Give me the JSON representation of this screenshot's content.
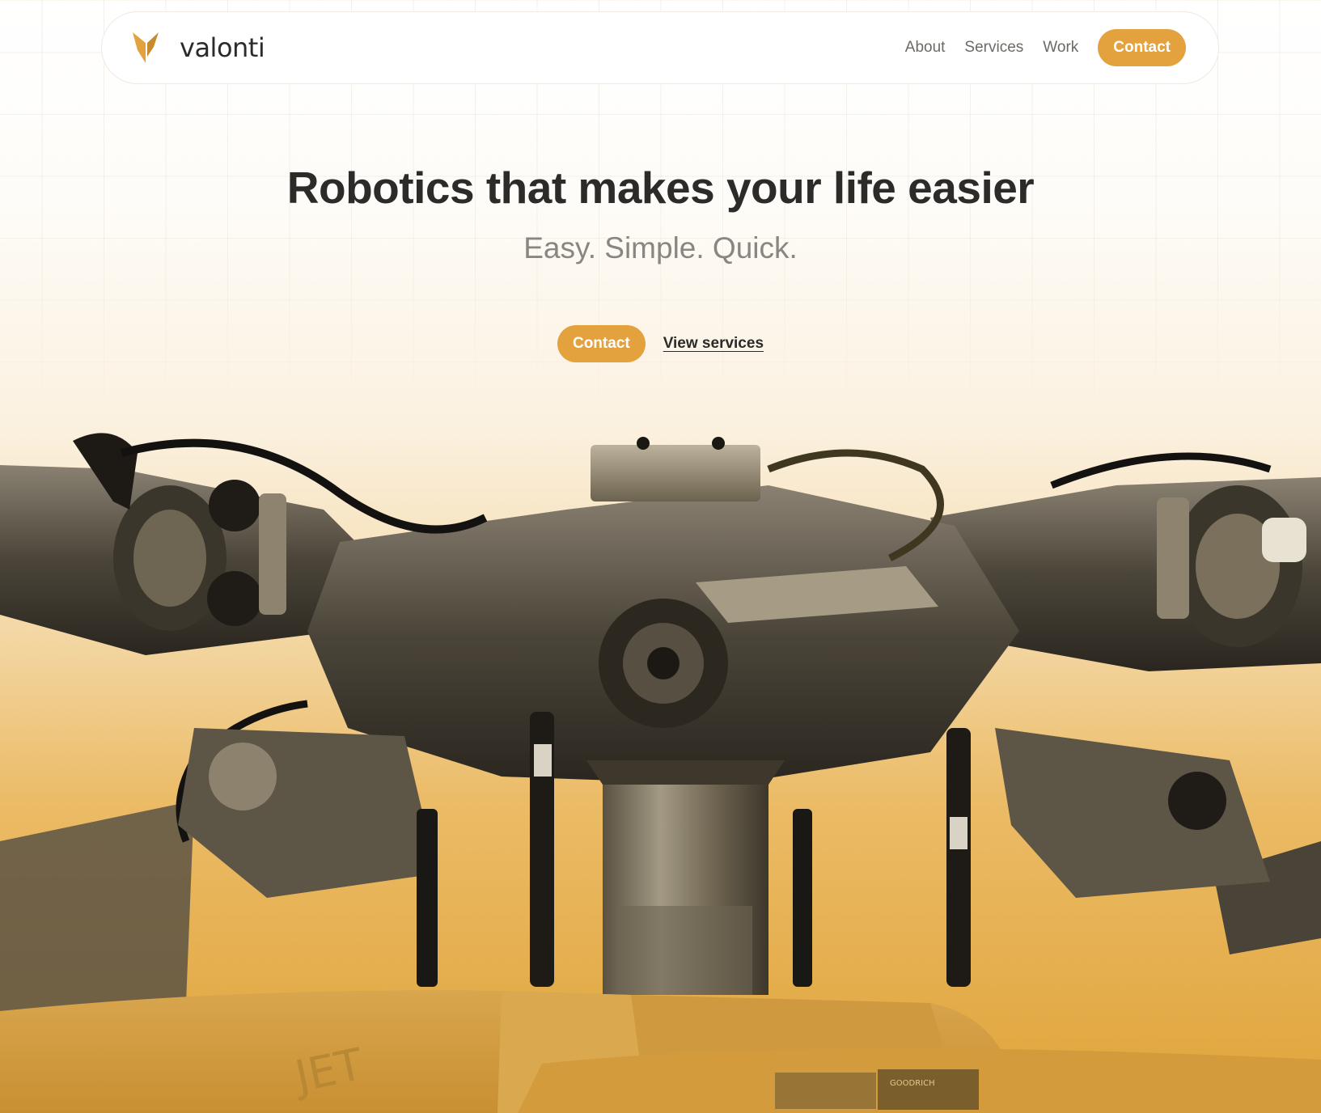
{
  "brand": {
    "name": "valonti",
    "logo_icon": "v-chevron-logo",
    "accent_color": "#e4a23e"
  },
  "nav": {
    "links": [
      {
        "label": "About"
      },
      {
        "label": "Services"
      },
      {
        "label": "Work"
      }
    ],
    "contact_label": "Contact"
  },
  "hero": {
    "title": "Robotics that makes your life easier",
    "subtitle": "Easy. Simple. Quick.",
    "primary_cta": "Contact",
    "secondary_cta": "View services"
  },
  "image": {
    "subject": "helicopter rotor hub",
    "plate_text": "GOODRICH",
    "body_text": "JET"
  },
  "colors": {
    "text_dark": "#2c2b29",
    "text_muted": "#8a8580",
    "accent": "#e4a23e"
  }
}
